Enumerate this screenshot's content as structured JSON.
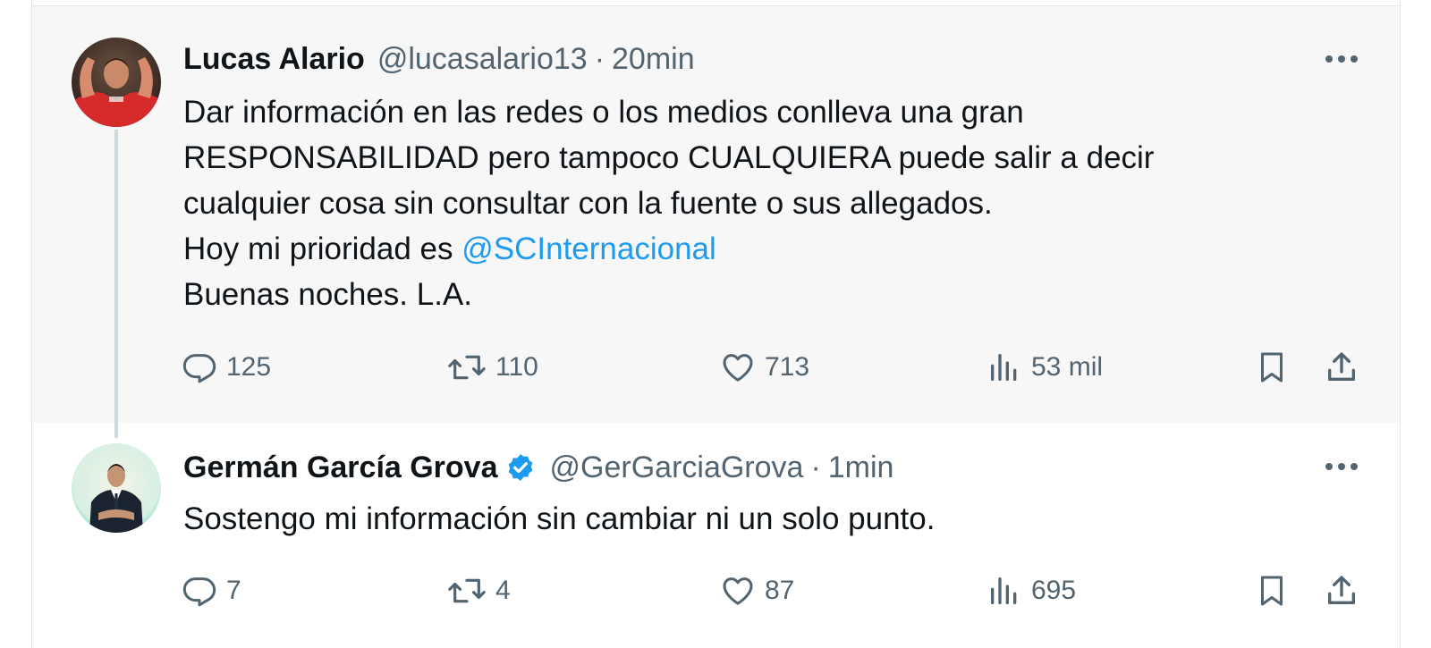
{
  "tweets": [
    {
      "name": "Lucas Alario",
      "handle": "@lucasalario13",
      "separator": "·",
      "time": "20min",
      "verified": false,
      "text_lines": [
        "Dar información en las redes o los medios conlleva una gran",
        "RESPONSABILIDAD pero tampoco CUALQUIERA puede salir a decir",
        "cualquier cosa sin consultar con la fuente o sus allegados."
      ],
      "line4_prefix": "Hoy mi prioridad es ",
      "mention": "@SCInternacional",
      "line5": "Buenas noches. L.A.",
      "stats": {
        "replies": "125",
        "reposts": "110",
        "likes": "713",
        "views": "53 mil"
      },
      "more_icon": "more-dots-icon"
    },
    {
      "name": "Germán García Grova",
      "handle": "@GerGarciaGrova",
      "separator": "·",
      "time": "1min",
      "verified": true,
      "text_lines": [
        "Sostengo mi información sin cambiar ni un solo punto."
      ],
      "stats": {
        "replies": "7",
        "reposts": "4",
        "likes": "87",
        "views": "695"
      },
      "more_icon": "more-dots-icon"
    }
  ],
  "icons": {
    "reply": "reply-icon",
    "repost": "repost-icon",
    "like": "heart-icon",
    "views": "views-icon",
    "bookmark": "bookmark-icon",
    "share": "share-icon",
    "verified": "verified-badge-icon"
  },
  "colors": {
    "text": "#0f1419",
    "muted": "#536471",
    "mention": "#1d9bf0",
    "verified": "#1d9bf0",
    "thread_line": "#cfd9de",
    "highlight_bg": "#f7f7f8"
  }
}
